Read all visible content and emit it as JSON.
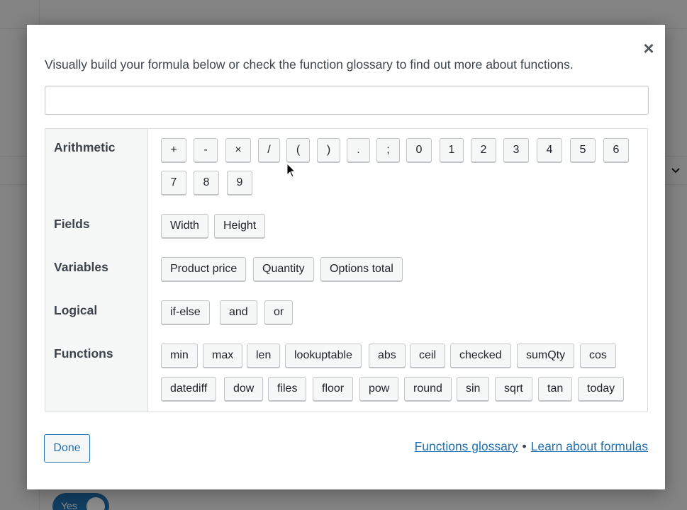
{
  "background": {
    "toggle_label": "Yes"
  },
  "modal": {
    "intro_text": "Visually build your formula below or check the function glossary to find out more about functions.",
    "close_icon": "×",
    "formula_value": "",
    "categories": {
      "arithmetic": "Arithmetic",
      "fields": "Fields",
      "variables": "Variables",
      "logical": "Logical",
      "functions": "Functions"
    },
    "arithmetic_tokens": [
      "+",
      "-",
      "×",
      "/",
      "(",
      ")",
      ".",
      ";",
      "0",
      "1",
      "2",
      "3",
      "4",
      "5",
      "6",
      "7",
      "8",
      "9"
    ],
    "field_tokens": [
      "Width",
      "Height"
    ],
    "variable_tokens": [
      "Product price",
      "Quantity",
      "Options total"
    ],
    "logical_tokens": [
      "if-else",
      "and",
      "or"
    ],
    "function_tokens": [
      "min",
      "max",
      "len",
      "lookuptable",
      "abs",
      "ceil",
      "checked",
      "sumQty",
      "cos",
      "datediff",
      "dow",
      "files",
      "floor",
      "pow",
      "round",
      "sin",
      "sqrt",
      "tan",
      "today"
    ],
    "done_label": "Done",
    "glossary_link": "Functions glossary",
    "separator": "•",
    "learn_link": "Learn about formulas"
  },
  "colors": {
    "accent": "#2271b1",
    "text": "#3c434a",
    "button_bg": "#f6f7f7",
    "border": "#c3c4c7"
  }
}
